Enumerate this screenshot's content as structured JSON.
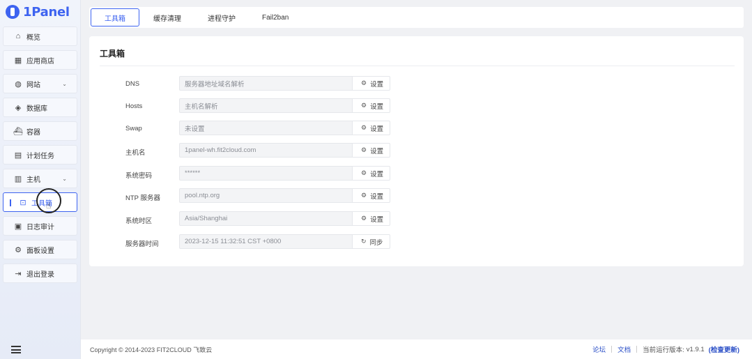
{
  "app": {
    "logo_text": "1Panel"
  },
  "sidebar": {
    "items": [
      {
        "label": "概览",
        "icon": "home-icon",
        "glyph": "⌂",
        "expandable": false,
        "active": false
      },
      {
        "label": "应用商店",
        "icon": "apps-icon",
        "glyph": "▦",
        "expandable": false,
        "active": false
      },
      {
        "label": "网站",
        "icon": "globe-icon",
        "glyph": "◍",
        "expandable": true,
        "active": false
      },
      {
        "label": "数据库",
        "icon": "database-icon",
        "glyph": "◈",
        "expandable": false,
        "active": false
      },
      {
        "label": "容器",
        "icon": "container-icon",
        "glyph": "⛴",
        "expandable": false,
        "active": false
      },
      {
        "label": "计划任务",
        "icon": "calendar-icon",
        "glyph": "▤",
        "expandable": false,
        "active": false
      },
      {
        "label": "主机",
        "icon": "host-icon",
        "glyph": "▥",
        "expandable": true,
        "active": false
      },
      {
        "label": "工具箱",
        "icon": "toolbox-icon",
        "glyph": "⊡",
        "expandable": false,
        "active": true
      },
      {
        "label": "日志审计",
        "icon": "log-icon",
        "glyph": "▣",
        "expandable": false,
        "active": false
      },
      {
        "label": "面板设置",
        "icon": "settings-icon",
        "glyph": "⚙",
        "expandable": false,
        "active": false
      },
      {
        "label": "退出登录",
        "icon": "logout-icon",
        "glyph": "⇥",
        "expandable": false,
        "active": false
      }
    ],
    "chevron": "⌄"
  },
  "tabs": [
    {
      "label": "工具箱",
      "active": true
    },
    {
      "label": "缓存清理",
      "active": false
    },
    {
      "label": "进程守护",
      "active": false
    },
    {
      "label": "Fail2ban",
      "active": false
    }
  ],
  "card": {
    "title": "工具箱",
    "rows": [
      {
        "label": "DNS",
        "value": "服务器地址域名解析",
        "button": "设置",
        "button_icon": "gear-icon",
        "glyph": "⚙"
      },
      {
        "label": "Hosts",
        "value": "主机名解析",
        "button": "设置",
        "button_icon": "gear-icon",
        "glyph": "⚙"
      },
      {
        "label": "Swap",
        "value": "未设置",
        "button": "设置",
        "button_icon": "gear-icon",
        "glyph": "⚙"
      },
      {
        "label": "主机名",
        "value": "1panel-wh.fit2cloud.com",
        "button": "设置",
        "button_icon": "gear-icon",
        "glyph": "⚙"
      },
      {
        "label": "系统密码",
        "value": "******",
        "button": "设置",
        "button_icon": "gear-icon",
        "glyph": "⚙"
      },
      {
        "label": "NTP 服务器",
        "value": "pool.ntp.org",
        "button": "设置",
        "button_icon": "gear-icon",
        "glyph": "⚙"
      },
      {
        "label": "系统时区",
        "value": "Asia/Shanghai",
        "button": "设置",
        "button_icon": "gear-icon",
        "glyph": "⚙"
      },
      {
        "label": "服务器时间",
        "value": "2023-12-15 11:32:51 CST +0800",
        "button": "同步",
        "button_icon": "refresh-icon",
        "glyph": "↻"
      }
    ]
  },
  "footer": {
    "copyright": "Copyright © 2014-2023 FIT2CLOUD 飞致云",
    "forum": "论坛",
    "docs": "文档",
    "version_label": "当前运行版本:",
    "version": "v1.9.1",
    "check_update": "(检查更新)"
  },
  "colors": {
    "accent": "#3d63f0",
    "link": "#2b4fc7"
  }
}
